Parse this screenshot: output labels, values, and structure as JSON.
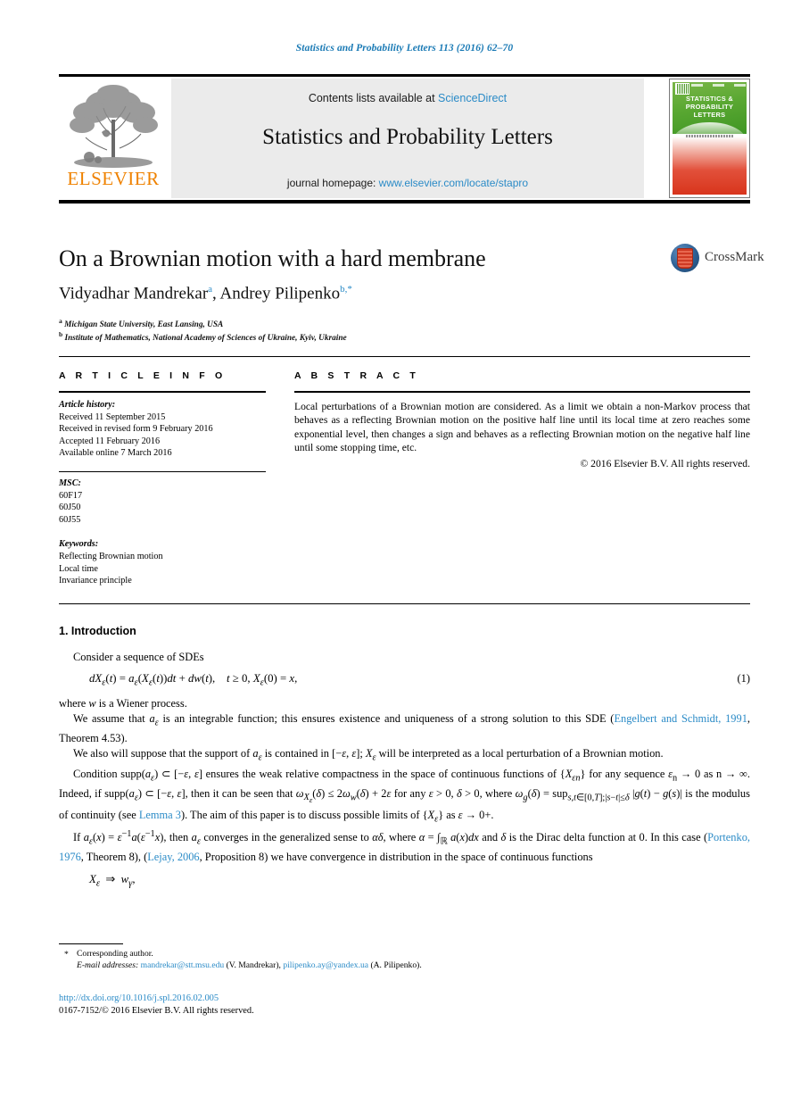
{
  "running_head": "Statistics and Probability Letters 113 (2016) 62–70",
  "masthead": {
    "publisher_name": "ELSEVIER",
    "contents_prefix": "Contents lists available at ",
    "contents_link": "ScienceDirect",
    "journal_name": "Statistics and Probability Letters",
    "homepage_prefix": "journal homepage: ",
    "homepage_link": "www.elsevier.com/locate/stapro",
    "cover_title": "STATISTICS &\nPROBABILITY\nLETTERS"
  },
  "article": {
    "title": "On a Brownian motion with a hard membrane",
    "crossmark_label": "CrossMark",
    "authors_html": "Vidyadhar Mandrekar<sup>a</sup>, Andrey Pilipenko<sup>b,*</sup>",
    "affiliations": [
      {
        "marker": "a",
        "text": "Michigan State University, East Lansing, USA"
      },
      {
        "marker": "b",
        "text": "Institute of Mathematics, National Academy of Sciences of Ukraine, Kyiv, Ukraine"
      }
    ]
  },
  "info": {
    "heading": "A R T I C L E   I N F O",
    "history_label": "Article history:",
    "history": [
      "Received 11 September 2015",
      "Received in revised form 9 February 2016",
      "Accepted 11 February 2016",
      "Available online 7 March 2016"
    ],
    "msc_label": "MSC:",
    "msc": [
      "60F17",
      "60J50",
      "60J55"
    ],
    "keywords_label": "Keywords:",
    "keywords": [
      "Reflecting Brownian motion",
      "Local time",
      "Invariance principle"
    ]
  },
  "abstract": {
    "heading": "A B S T R A C T",
    "text": "Local perturbations of a Brownian motion are considered. As a limit we obtain a non-Markov process that behaves as a reflecting Brownian motion on the positive half line until its local time at zero reaches some exponential level, then changes a sign and behaves as a reflecting Brownian motion on the negative half line until some stopping time, etc.",
    "copyright": "© 2016 Elsevier B.V. All rights reserved."
  },
  "body": {
    "section_heading": "1. Introduction",
    "p1": "Consider a sequence of SDEs",
    "equation_1": "dXε(t) = aε(Xε(t))dt + dw(t),    t ≥ 0, Xε(0) = x,",
    "equation_1_number": "(1)",
    "p2": "where w is a Wiener process.",
    "p3_a": "We assume that a",
    "p3_full": "We assume that aε is an integrable function; this ensures existence and uniqueness of a strong solution to this SDE (",
    "ref_engelbert": "Engelbert and Schmidt, 1991",
    "p3_tail": ", Theorem 4.53).",
    "p4": "We also will suppose that the support of aε is contained in [−ε, ε]; Xε will be interpreted as a local perturbation of a Brownian motion.",
    "p5_a": "Condition supp(aε) ⊂ [−ε, ε] ensures the weak relative compactness in the space of continuous functions of {Xεn} for any sequence εn → 0 as n → ∞. Indeed, if supp(aε) ⊂ [−ε, ε], then it can be seen that ωXε(δ) ≤ 2ωw(δ) + 2ε for any ε > 0, δ > 0, where ωg(δ) = sups,t∈[0,T];|s−t|≤δ |g(t) − g(s)| is the modulus of continuity (see ",
    "ref_lemma3": "Lemma 3",
    "p5_b": "). The aim of this paper is to discuss possible limits of {Xε} as ε → 0+.",
    "p6_a": "If aε(x) = ε⁻¹a(ε⁻¹x), then aε converges in the generalized sense to αδ, where α = ∫ℝ a(x)dx and δ is the Dirac delta function at 0. In this case (",
    "ref_portenko": "Portenko, 1976",
    "p6_b": ", Theorem 8), (",
    "ref_lejay": "Lejay, 2006",
    "p6_c": ", Proposition 8) we have convergence in distribution in the space of continuous functions",
    "equation_2": "Xε ⇒ wγ,"
  },
  "footnotes": {
    "corresponding_star": "*",
    "corresponding_text": "Corresponding author.",
    "email_label": "E-mail addresses:",
    "email_1": "mandrekar@stt.msu.edu",
    "email_1_name": "(V. Mandrekar)",
    "email_2": "pilipenko.ay@yandex.ua",
    "email_2_name": "(A. Pilipenko)",
    "doi": "http://dx.doi.org/10.1016/j.spl.2016.02.005",
    "issn_line": "0167-7152/© 2016 Elsevier B.V. All rights reserved."
  },
  "colors": {
    "link_blue": "#2b8bc7",
    "header_blue": "#1a7ab5",
    "elsevier_orange": "#ef8200",
    "band_gray": "#ebebeb"
  }
}
